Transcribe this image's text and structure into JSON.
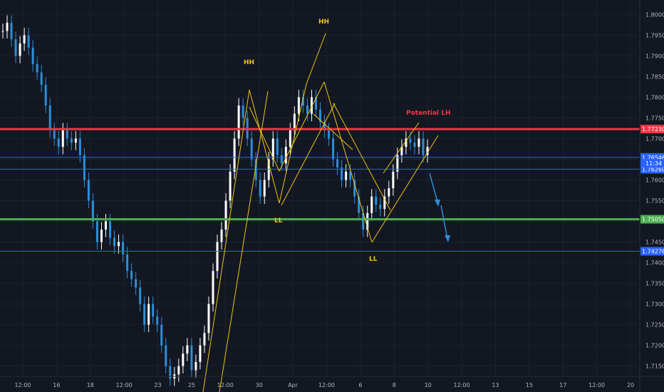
{
  "chart_data": {
    "type": "candlestick",
    "y_axis": {
      "range": [
        1.7127,
        1.8035
      ],
      "ticks": [
        "1.80000",
        "1.79500",
        "1.79000",
        "1.78500",
        "1.78000",
        "1.77500",
        "1.77000",
        "1.76500",
        "1.76000",
        "1.75500",
        "1.75000",
        "1.74500",
        "1.74000",
        "1.73500",
        "1.73000",
        "1.72500",
        "1.72000",
        "1.71500"
      ],
      "tick_values": [
        1.8,
        1.795,
        1.79,
        1.785,
        1.78,
        1.775,
        1.77,
        1.765,
        1.76,
        1.755,
        1.75,
        1.745,
        1.74,
        1.735,
        1.73,
        1.725,
        1.72,
        1.715
      ]
    },
    "x_axis": {
      "ticks": [
        "12:00",
        "16",
        "18",
        "12:00",
        "23",
        "25",
        "12:00",
        "30",
        "Apr",
        "12:00",
        "6",
        "8",
        "10",
        "12:00",
        "13",
        "15",
        "17",
        "12:00",
        "20"
      ]
    },
    "horizontal_levels": [
      {
        "label": "1.77230",
        "value": 1.7723,
        "color": "#f23645",
        "style": "thick"
      },
      {
        "label": "1.76546",
        "value": 1.76546,
        "color": "#2962ff",
        "style": "thin"
      },
      {
        "label": "1.76260",
        "value": 1.7626,
        "color": "#2962ff",
        "style": "thin"
      },
      {
        "label": "1.75050",
        "value": 1.7505,
        "color": "#4caf50",
        "style": "thick"
      },
      {
        "label": "1.74276",
        "value": 1.74276,
        "color": "#2962ff",
        "style": "thin"
      }
    ],
    "countdown": "11:34",
    "annotations": [
      {
        "text": "HH",
        "color": "#f0c419"
      },
      {
        "text": "HH",
        "color": "#f0c419"
      },
      {
        "text": "LL",
        "color": "#f0c419"
      },
      {
        "text": "LL",
        "color": "#f0c419"
      },
      {
        "text": "Potential LH",
        "color": "#f23645"
      }
    ],
    "candle_closes": [
      1.796,
      1.798,
      1.794,
      1.79,
      1.793,
      1.795,
      1.792,
      1.788,
      1.786,
      1.783,
      1.778,
      1.772,
      1.77,
      1.768,
      1.772,
      1.77,
      1.769,
      1.77,
      1.766,
      1.76,
      1.755,
      1.75,
      1.745,
      1.748,
      1.75,
      1.746,
      1.744,
      1.745,
      1.742,
      1.738,
      1.736,
      1.734,
      1.73,
      1.725,
      1.73,
      1.727,
      1.725,
      1.72,
      1.715,
      1.712,
      1.713,
      1.715,
      1.718,
      1.72,
      1.714,
      1.716,
      1.72,
      1.723,
      1.73,
      1.738,
      1.745,
      1.748,
      1.755,
      1.762,
      1.77,
      1.778,
      1.775,
      1.77,
      1.765,
      1.76,
      1.756,
      1.76,
      1.765,
      1.77,
      1.766,
      1.764,
      1.768,
      1.772,
      1.776,
      1.78,
      1.778,
      1.776,
      1.78,
      1.777,
      1.774,
      1.772,
      1.77,
      1.765,
      1.763,
      1.76,
      1.762,
      1.76,
      1.756,
      1.752,
      1.748,
      1.752,
      1.756,
      1.754,
      1.753,
      1.756,
      1.758,
      1.762,
      1.766,
      1.768,
      1.77,
      1.769,
      1.768,
      1.77,
      1.766,
      1.768
    ]
  }
}
